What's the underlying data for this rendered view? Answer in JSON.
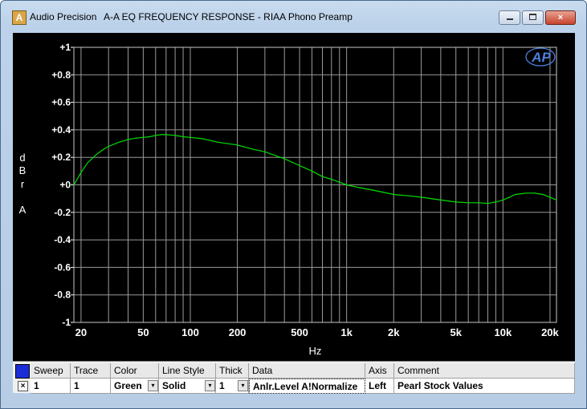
{
  "window": {
    "app_title": "Audio Precision",
    "doc_title": "A-A EQ FREQUENCY RESPONSE - RIAA Phono Preamp",
    "icon": "audio-precision-app-icon",
    "buttons": {
      "minimize": "minimize-icon",
      "maximize": "maximize-icon",
      "close": "×"
    }
  },
  "logo": {
    "text": "AP",
    "color": "#4d7fe0"
  },
  "colors": {
    "background": "#000000",
    "grid": "#9a9a9a",
    "trace": "#00e000"
  },
  "chart_data": {
    "type": "line",
    "xlabel": "Hz",
    "ylabel_chars": [
      "d",
      "B",
      "r",
      "",
      "A"
    ],
    "x_scale": "log",
    "xlim": [
      18,
      22000
    ],
    "ylim": [
      -1,
      1
    ],
    "x_ticks": [
      {
        "v": 20,
        "label": "20"
      },
      {
        "v": 50,
        "label": "50"
      },
      {
        "v": 100,
        "label": "100"
      },
      {
        "v": 200,
        "label": "200"
      },
      {
        "v": 500,
        "label": "500"
      },
      {
        "v": 1000,
        "label": "1k"
      },
      {
        "v": 2000,
        "label": "2k"
      },
      {
        "v": 5000,
        "label": "5k"
      },
      {
        "v": 10000,
        "label": "10k"
      },
      {
        "v": 20000,
        "label": "20k"
      }
    ],
    "y_ticks": [
      {
        "v": 1,
        "label": "+1"
      },
      {
        "v": 0.8,
        "label": "+0.8"
      },
      {
        "v": 0.6,
        "label": "+0.6"
      },
      {
        "v": 0.4,
        "label": "+0.4"
      },
      {
        "v": 0.2,
        "label": "+0.2"
      },
      {
        "v": 0,
        "label": "+0"
      },
      {
        "v": -0.2,
        "label": "-0.2"
      },
      {
        "v": -0.4,
        "label": "-0.4"
      },
      {
        "v": -0.6,
        "label": "-0.6"
      },
      {
        "v": -0.8,
        "label": "-0.8"
      },
      {
        "v": -1,
        "label": "-1"
      }
    ],
    "grid": true,
    "series": [
      {
        "color": "#00e000",
        "x": [
          18,
          20,
          22,
          25,
          28,
          30,
          35,
          40,
          45,
          50,
          55,
          60,
          65,
          70,
          80,
          90,
          100,
          120,
          150,
          200,
          250,
          300,
          400,
          500,
          600,
          700,
          800,
          1000,
          1200,
          1500,
          2000,
          2500,
          3000,
          4000,
          5000,
          6000,
          7000,
          8000,
          9000,
          10000,
          11000,
          12000,
          14000,
          16000,
          18000,
          20000,
          22000
        ],
        "y": [
          0.0,
          0.09,
          0.16,
          0.22,
          0.26,
          0.28,
          0.31,
          0.33,
          0.34,
          0.345,
          0.35,
          0.36,
          0.365,
          0.365,
          0.36,
          0.35,
          0.345,
          0.335,
          0.31,
          0.29,
          0.26,
          0.24,
          0.19,
          0.14,
          0.1,
          0.06,
          0.04,
          0.0,
          -0.02,
          -0.04,
          -0.07,
          -0.08,
          -0.09,
          -0.11,
          -0.125,
          -0.13,
          -0.13,
          -0.135,
          -0.125,
          -0.11,
          -0.09,
          -0.07,
          -0.06,
          -0.06,
          -0.07,
          -0.09,
          -0.11
        ]
      }
    ]
  },
  "table": {
    "headers": [
      "Sweep",
      "Trace",
      "Color",
      "Line Style",
      "Thick",
      "Data",
      "Axis",
      "Comment"
    ],
    "row": {
      "check": "×",
      "sweep": "1",
      "trace": "1",
      "color": "Green",
      "line_style": "Solid",
      "thick": "1",
      "data": "Anlr.Level A!Normalize",
      "axis": "Left",
      "comment": "Pearl Stock Values"
    },
    "dropdown_icon": "▾"
  }
}
